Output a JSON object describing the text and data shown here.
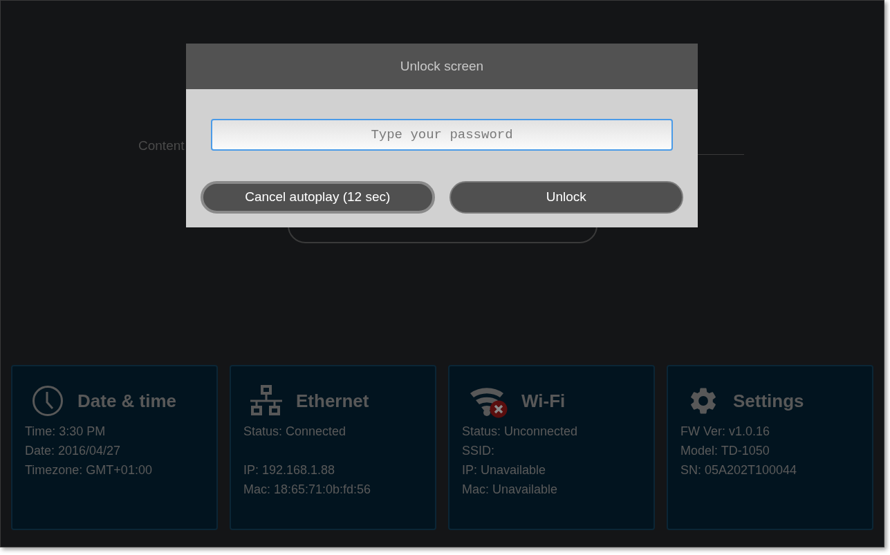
{
  "background": {
    "content_label": "Content"
  },
  "dialog": {
    "title": "Unlock screen",
    "password": {
      "placeholder": "Type your password"
    },
    "buttons": [
      {
        "label": "Cancel autoplay (12 sec)",
        "focused": true
      },
      {
        "label": "Unlock",
        "focused": false
      }
    ]
  },
  "cards": [
    {
      "kind": "clock",
      "title": "Date & time",
      "line_groups": [
        [
          "Time: 3:30 PM",
          "Date: 2016/04/27",
          "Timezone: GMT+01:00"
        ]
      ]
    },
    {
      "kind": "network",
      "title": "Ethernet",
      "line_groups": [
        [
          "Status: Connected"
        ],
        [
          "IP: 192.168.1.88",
          "Mac: 18:65:71:0b:fd:56"
        ]
      ]
    },
    {
      "kind": "wifi",
      "title": "Wi-Fi",
      "line_groups": [
        [
          "Status: Unconnected",
          "SSID:",
          "IP: Unavailable",
          "Mac: Unavailable"
        ]
      ]
    },
    {
      "kind": "gear",
      "title": "Settings",
      "line_groups": [
        [
          "FW Ver: v1.0.16",
          "Model: TD-1050",
          "SN: 05A202T100044"
        ]
      ]
    }
  ]
}
